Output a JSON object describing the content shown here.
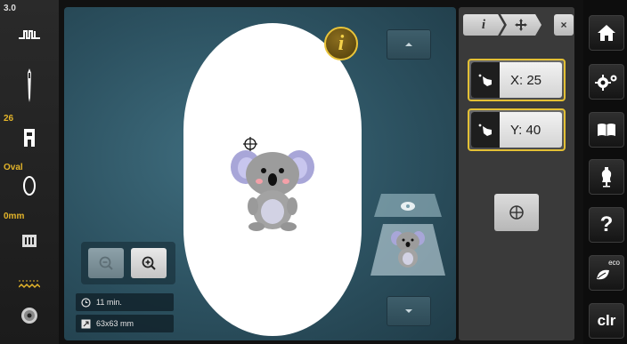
{
  "left_bar": {
    "version_label": "3.0",
    "presser_foot_number": "26",
    "hoop_label": "Oval",
    "thread_offset_label": "0mm"
  },
  "canvas": {
    "info_icon": "info-icon",
    "stats": {
      "time": "11 min.",
      "size": "63x63 mm"
    }
  },
  "right_panel": {
    "tabs": [
      "info-tab",
      "move-tab",
      "close-tab"
    ],
    "x_button_label": "X: 25",
    "y_button_label": "Y: 40"
  },
  "right_bar": {
    "items": [
      "home-icon",
      "setup-icon",
      "tutorial-icon",
      "consultant-icon",
      "help-icon",
      "eco-icon",
      "clear-button"
    ],
    "eco_label": "eco",
    "clr_label": "clr"
  },
  "colors": {
    "accent": "#e3c035",
    "canvas_bg": "#2c5160",
    "left_label": "#e3b42a"
  }
}
